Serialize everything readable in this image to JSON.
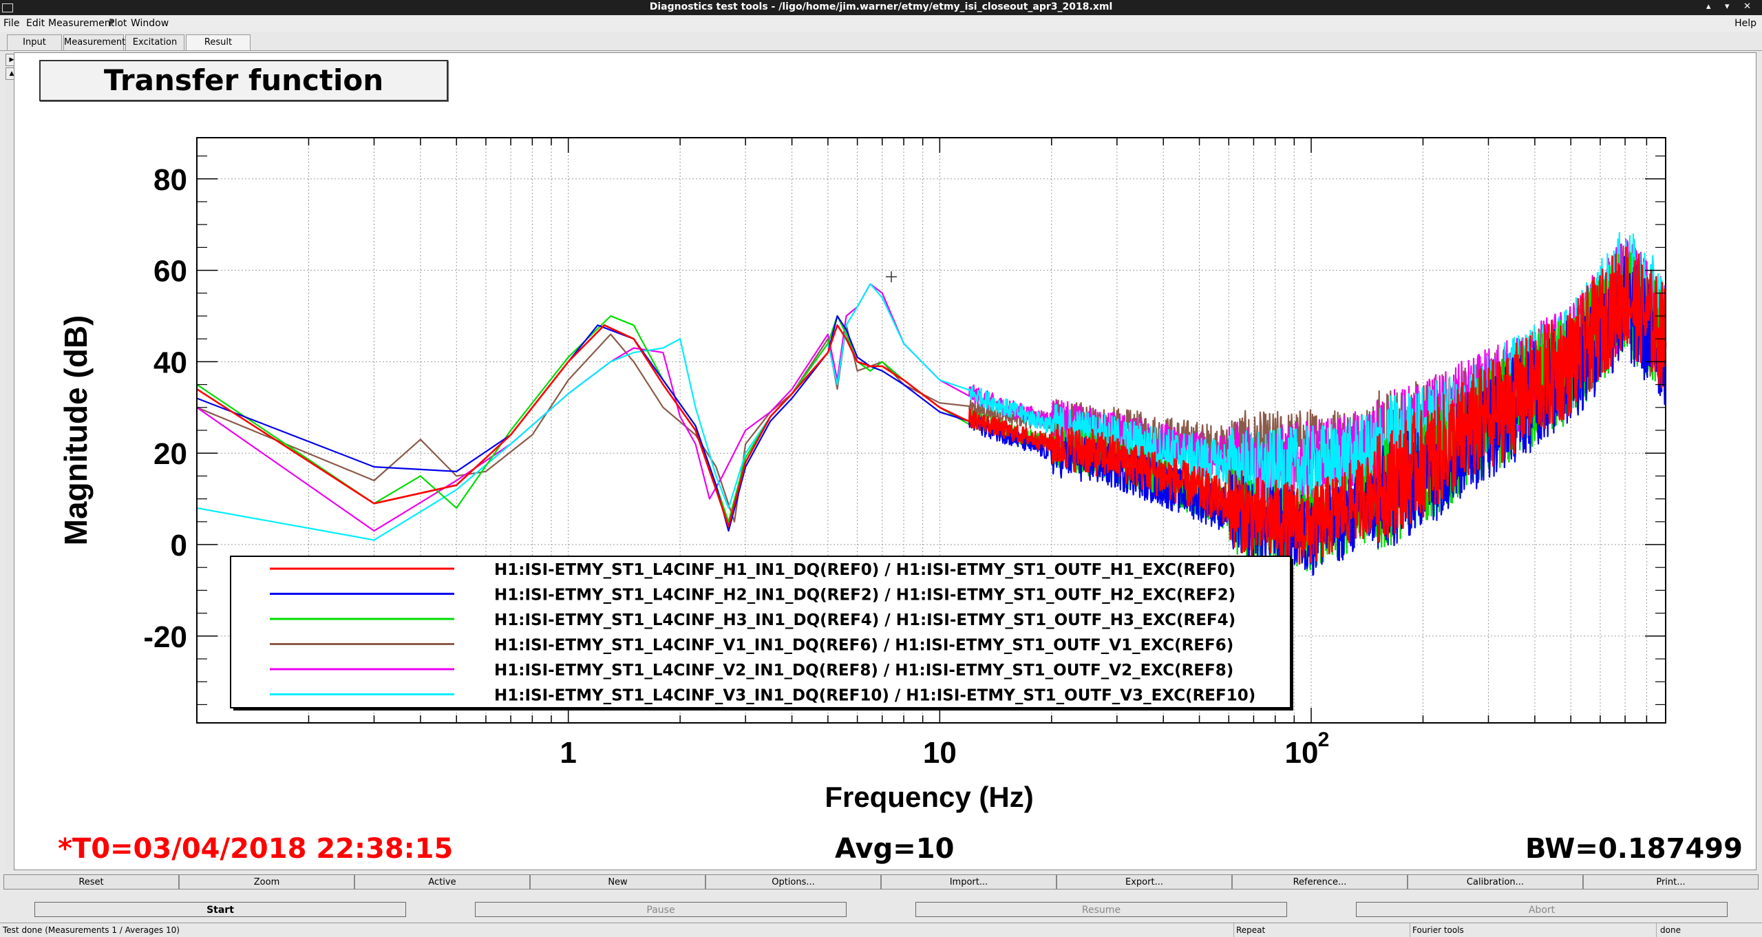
{
  "window": {
    "title": "Diagnostics test tools - /ligo/home/jim.warner/etmy/etmy_isi_closeout_apr3_2018.xml",
    "controls": "▴ ▾ ✕"
  },
  "menu": {
    "items": [
      "File",
      "Edit",
      "Measurement",
      "Plot",
      "Window"
    ],
    "help": "Help"
  },
  "tabs": [
    "Input",
    "Measurement",
    "Excitation",
    "Result"
  ],
  "active_tab": "Result",
  "plot": {
    "title": "Transfer function"
  },
  "chart_data": {
    "type": "line",
    "xscale": "log",
    "xlim": [
      0.1,
      900
    ],
    "ylim": [
      -39,
      89
    ],
    "grid": true,
    "xlabel": "Frequency (Hz)",
    "ylabel": "Magnitude (dB)",
    "x_ticks": [
      1,
      10,
      100
    ],
    "x_tick_labels": [
      "1",
      "10",
      "10"
    ],
    "x_tick_exponent": "2",
    "y_ticks": [
      -20,
      0,
      20,
      40,
      60,
      80
    ],
    "y_tick_labels": [
      "-20",
      "0",
      "20",
      "40",
      "60",
      "80"
    ],
    "legend_placement": "bottom-left",
    "series": [
      {
        "name": "H1:ISI-ETMY_ST1_L4CINF_H1_IN1_DQ(REF0) / H1:ISI-ETMY_ST1_OUTF_H1_EXC(REF0)",
        "color": "#ff0000",
        "x": [
          0.1,
          0.3,
          0.5,
          0.7,
          1.0,
          1.25,
          1.5,
          1.8,
          2.2,
          2.5,
          2.7,
          3.0,
          3.5,
          4.0,
          5.0,
          5.3,
          5.6,
          6.0,
          6.5,
          7.0,
          8.0,
          10,
          15,
          20,
          30,
          50,
          70,
          100,
          150,
          200,
          300,
          500,
          700,
          900
        ],
        "y": [
          34,
          9,
          13,
          24,
          40,
          48,
          45,
          35,
          25,
          12,
          4,
          18,
          28,
          33,
          42,
          48,
          45,
          40,
          39,
          39,
          36,
          30,
          25,
          22,
          19,
          12,
          6,
          4,
          12,
          18,
          28,
          40,
          55,
          45
        ]
      },
      {
        "name": "H1:ISI-ETMY_ST1_L4CINF_H2_IN1_DQ(REF2) / H1:ISI-ETMY_ST1_OUTF_H2_EXC(REF2)",
        "color": "#0000ee",
        "x": [
          0.1,
          0.3,
          0.5,
          0.7,
          1.0,
          1.2,
          1.5,
          1.8,
          2.2,
          2.5,
          2.7,
          3.0,
          3.5,
          4.0,
          5.0,
          5.3,
          5.6,
          6.0,
          6.5,
          7.0,
          8.0,
          10,
          15,
          20,
          30,
          50,
          70,
          100,
          150,
          200,
          300,
          500,
          700,
          900
        ],
        "y": [
          32,
          17,
          16,
          24,
          40,
          48,
          45,
          36,
          26,
          13,
          3,
          17,
          27,
          32,
          42,
          50,
          47,
          41,
          39,
          38,
          35,
          29,
          24,
          20,
          17,
          10,
          5,
          2,
          9,
          15,
          26,
          38,
          52,
          42
        ]
      },
      {
        "name": "H1:ISI-ETMY_ST1_L4CINF_H3_IN1_DQ(REF4) / H1:ISI-ETMY_ST1_OUTF_H3_EXC(REF4)",
        "color": "#00dd00",
        "x": [
          0.1,
          0.3,
          0.4,
          0.5,
          0.7,
          1.0,
          1.3,
          1.5,
          1.8,
          2.2,
          2.5,
          2.7,
          3.0,
          3.5,
          4.0,
          5.0,
          5.3,
          5.6,
          6.0,
          6.5,
          7.0,
          8.0,
          10,
          15,
          20,
          30,
          50,
          70,
          100,
          150,
          200,
          300,
          500,
          700,
          900
        ],
        "y": [
          35,
          9,
          15,
          8,
          25,
          41,
          50,
          48,
          36,
          26,
          13,
          5,
          19,
          28,
          33,
          44,
          50,
          46,
          40,
          38,
          40,
          36,
          30,
          25,
          22,
          18,
          11,
          5,
          3,
          10,
          16,
          27,
          39,
          54,
          44
        ]
      },
      {
        "name": "H1:ISI-ETMY_ST1_L4CINF_V1_IN1_DQ(REF6) / H1:ISI-ETMY_ST1_OUTF_V1_EXC(REF6)",
        "color": "#8b5a4a",
        "x": [
          0.1,
          0.3,
          0.4,
          0.5,
          0.6,
          0.8,
          1.0,
          1.3,
          1.5,
          1.8,
          2.2,
          2.5,
          2.8,
          3.0,
          3.5,
          4.0,
          5.0,
          5.3,
          5.6,
          6.0,
          6.5,
          7.0,
          8.0,
          10,
          15,
          20,
          30,
          50,
          70,
          100,
          150,
          200,
          300,
          500,
          700,
          900
        ],
        "y": [
          30,
          14,
          23,
          15,
          16,
          24,
          36,
          46,
          40,
          30,
          24,
          17,
          5,
          22,
          29,
          33,
          45,
          34,
          48,
          38,
          39,
          40,
          35,
          31,
          28,
          27,
          25,
          22,
          20,
          21,
          22,
          24,
          30,
          40,
          55,
          45
        ]
      },
      {
        "name": "H1:ISI-ETMY_ST1_L4CINF_V2_IN1_DQ(REF8) / H1:ISI-ETMY_ST1_OUTF_V2_EXC(REF8)",
        "color": "#ee00ee",
        "x": [
          0.1,
          0.3,
          0.5,
          0.7,
          1.0,
          1.3,
          1.5,
          1.8,
          2.0,
          2.2,
          2.4,
          2.6,
          3.0,
          3.5,
          4.0,
          5.0,
          5.3,
          5.6,
          6.0,
          6.5,
          7.0,
          8.0,
          10,
          15,
          20,
          30,
          50,
          70,
          100,
          150,
          200,
          300,
          500,
          700,
          900
        ],
        "y": [
          30,
          3,
          14,
          22,
          33,
          40,
          43,
          42,
          28,
          22,
          10,
          15,
          25,
          29,
          34,
          46,
          36,
          50,
          52,
          57,
          55,
          44,
          36,
          30,
          27,
          24,
          20,
          17,
          18,
          21,
          24,
          31,
          41,
          56,
          46
        ]
      },
      {
        "name": "H1:ISI-ETMY_ST1_L4CINF_V3_IN1_DQ(REF10) / H1:ISI-ETMY_ST1_OUTF_V3_EXC(REF10)",
        "color": "#00eeff",
        "x": [
          0.1,
          0.3,
          0.5,
          0.7,
          1.0,
          1.3,
          1.5,
          1.8,
          2.0,
          2.2,
          2.5,
          2.7,
          3.0,
          3.5,
          4.0,
          5.0,
          5.3,
          5.6,
          6.0,
          6.5,
          7.0,
          8.0,
          10,
          15,
          20,
          30,
          50,
          70,
          100,
          150,
          200,
          300,
          500,
          700,
          900
        ],
        "y": [
          8,
          1,
          12,
          22,
          33,
          40,
          42,
          43,
          45,
          30,
          15,
          8,
          20,
          28,
          33,
          44,
          35,
          48,
          52,
          57,
          54,
          44,
          36,
          30,
          26,
          23,
          19,
          16,
          17,
          20,
          23,
          30,
          41,
          58,
          48
        ]
      }
    ]
  },
  "info": {
    "t0": "*T0=03/04/2018 22:38:15",
    "avg": "Avg=10",
    "bw": "BW=0.187499"
  },
  "buttons": [
    "Reset",
    "Zoom",
    "Active",
    "New",
    "Options...",
    "Import...",
    "Export...",
    "Reference...",
    "Calibration...",
    "Print..."
  ],
  "controls": [
    "Start",
    "Pause",
    "Resume",
    "Abort"
  ],
  "status": {
    "message": "Test done (Measurements 1 / Averages 10)",
    "repeat": "Repeat",
    "fourier": "Fourier tools",
    "done": "done"
  },
  "colors": {
    "red_info": "#ff0000"
  }
}
